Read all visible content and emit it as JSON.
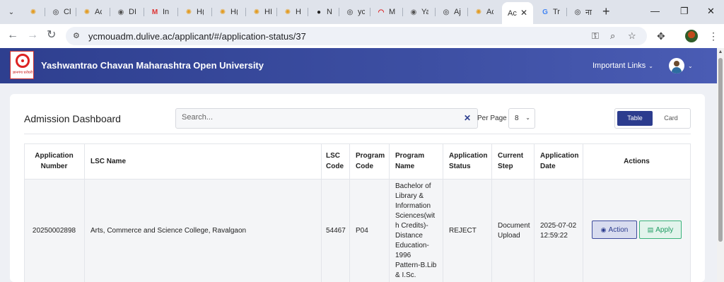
{
  "browser": {
    "tabs": [
      {
        "icon": "sun-favicon",
        "glyph": "✺",
        "color": "#e39b1f",
        "label": ""
      },
      {
        "icon": "chatgpt-favicon",
        "glyph": "◎",
        "color": "#222",
        "label": "Cl"
      },
      {
        "icon": "sun-favicon",
        "glyph": "✺",
        "color": "#e39b1f",
        "label": "Ac"
      },
      {
        "icon": "globe-favicon",
        "glyph": "◉",
        "color": "#555",
        "label": "DI"
      },
      {
        "icon": "gmail-favicon",
        "glyph": "M",
        "color": "#d33",
        "label": "In"
      },
      {
        "icon": "sun-favicon",
        "glyph": "✺",
        "color": "#e39b1f",
        "label": "H("
      },
      {
        "icon": "sun-favicon",
        "glyph": "✺",
        "color": "#e39b1f",
        "label": "H("
      },
      {
        "icon": "sun-favicon",
        "glyph": "✺",
        "color": "#e39b1f",
        "label": "HI"
      },
      {
        "icon": "sun-favicon",
        "glyph": "✺",
        "color": "#e39b1f",
        "label": "H"
      },
      {
        "icon": "github-favicon",
        "glyph": "●",
        "color": "#222",
        "label": "N"
      },
      {
        "icon": "openai-favicon",
        "glyph": "◎",
        "color": "#222",
        "label": "yc"
      },
      {
        "icon": "arc-favicon",
        "glyph": "◠",
        "color": "#d22",
        "label": "M"
      },
      {
        "icon": "globe-favicon",
        "glyph": "◉",
        "color": "#555",
        "label": "Ya"
      },
      {
        "icon": "openai-favicon",
        "glyph": "◎",
        "color": "#222",
        "label": "Aj"
      },
      {
        "icon": "sun-favicon",
        "glyph": "✺",
        "color": "#e39b1f",
        "label": "Ac"
      },
      {
        "icon": "sun-favicon",
        "glyph": "",
        "color": "#e39b1f",
        "label": "Ac"
      },
      {
        "icon": "google-favicon",
        "glyph": "G",
        "color": "#4285f4",
        "label": "Tr"
      },
      {
        "icon": "chatgpt-favicon",
        "glyph": "◎",
        "color": "#222",
        "label": "ना"
      }
    ],
    "url": "ycmouadm.dulive.ac/applicant/#/application-status/37"
  },
  "header": {
    "logo_text": "ज्ञानगंगा घरोघरी",
    "university_name": "Yashwantrao Chavan Maharashtra Open University",
    "important_links": "Important Links"
  },
  "dashboard": {
    "title": "Admission Dashboard",
    "search_placeholder": "Search...",
    "per_page_label": "Per Page",
    "per_page_value": "8",
    "view_table": "Table",
    "view_card": "Card"
  },
  "table": {
    "headers": {
      "application_number": "Application Number",
      "lsc_name": "LSC Name",
      "lsc_code": "LSC Code",
      "program_code": "Program Code",
      "program_name": "Program Name",
      "application_status": "Application Status",
      "current_step": "Current Step",
      "application_date": "Application Date",
      "actions": "Actions"
    },
    "rows": [
      {
        "application_number": "20250002898",
        "lsc_name": "Arts, Commerce and Science College, Ravalgaon",
        "lsc_code": "54467",
        "program_code": "P04",
        "program_name": "Bachelor of Library & Information Sciences(with Credits)-Distance Education-1996 Pattern-B.Lib & I.Sc.",
        "application_status": "REJECT",
        "current_step": "Document Upload",
        "application_date": "2025-07-02 12:59:22",
        "action_label": "Action",
        "apply_label": "Apply"
      }
    ]
  }
}
